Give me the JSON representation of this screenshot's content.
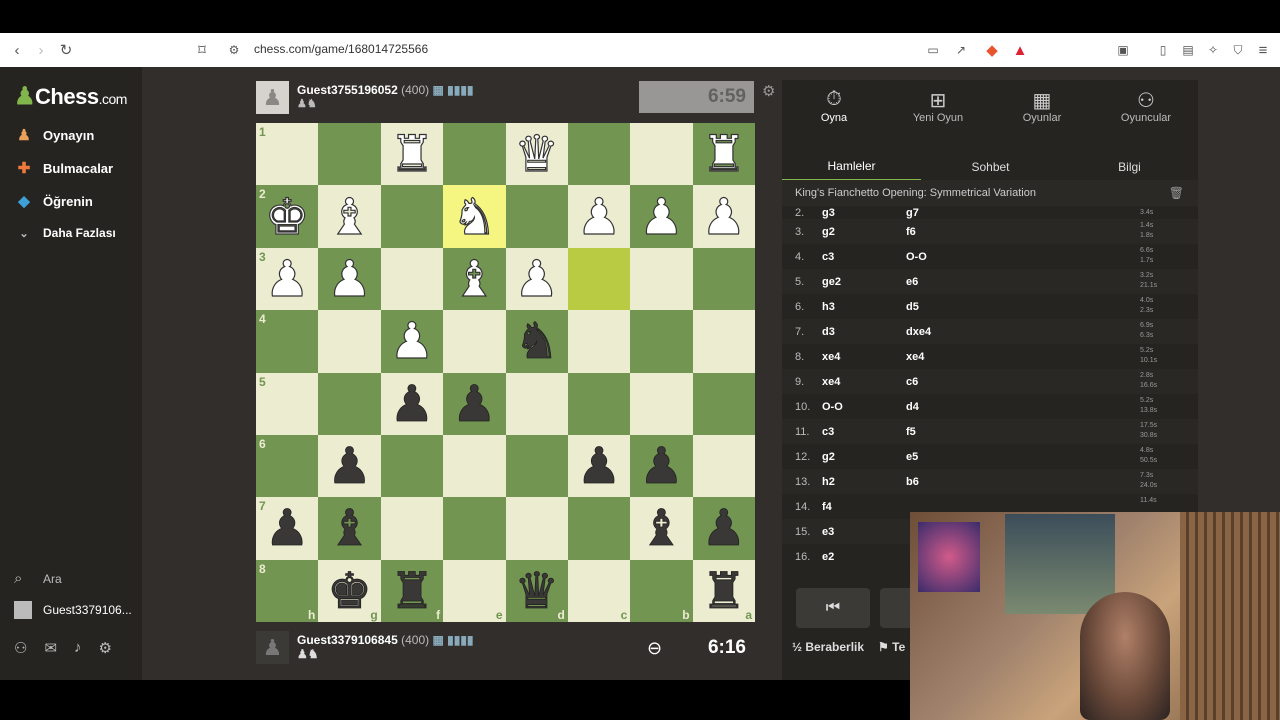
{
  "browser": {
    "url": "chess.com/game/168014725566"
  },
  "sidebar": {
    "logo_text": "Chess",
    "logo_suffix": ".com",
    "items": [
      {
        "label": "Oynayın",
        "icon": "play-icon"
      },
      {
        "label": "Bulmacalar",
        "icon": "puzzle-icon"
      },
      {
        "label": "Öğrenin",
        "icon": "learn-icon"
      },
      {
        "label": "Daha Fazlası",
        "icon": "chevron-down-icon"
      }
    ],
    "search_label": "Ara",
    "user_label": "Guest3379106..."
  },
  "top_player": {
    "name": "Guest3755196052",
    "rating": "(400)",
    "clock": "6:59"
  },
  "bottom_player": {
    "name": "Guest3379106845",
    "rating": "(400)",
    "clock": "6:16"
  },
  "board": {
    "ranks": [
      "1",
      "2",
      "3",
      "4",
      "5",
      "6",
      "7",
      "8"
    ],
    "files": [
      "h",
      "g",
      "f",
      "e",
      "d",
      "c",
      "b",
      "a"
    ],
    "rows": [
      [
        "",
        "",
        "wR",
        "",
        "wQ",
        "",
        "",
        "wR"
      ],
      [
        "wK",
        "wB",
        "",
        "wN",
        "",
        "wP",
        "wP",
        "wP"
      ],
      [
        "wP",
        "wP",
        "",
        "wB",
        "wP",
        "",
        "",
        ""
      ],
      [
        "",
        "",
        "wP",
        "",
        "bN",
        "",
        "",
        ""
      ],
      [
        "",
        "",
        "bP",
        "bP",
        "",
        "",
        "",
        ""
      ],
      [
        "",
        "bP",
        "",
        "",
        "",
        "bP",
        "bP",
        ""
      ],
      [
        "bP",
        "bB",
        "",
        "",
        "",
        "",
        "bB",
        "bP"
      ],
      [
        "",
        "bK",
        "bR",
        "",
        "bQ",
        "",
        "",
        "bR"
      ]
    ],
    "highlights": {
      "from": "f3",
      "to": "e2"
    }
  },
  "panel": {
    "top_tabs": [
      {
        "label": "Oyna",
        "icon": "stopwatch-icon"
      },
      {
        "label": "Yeni Oyun",
        "icon": "plus-icon"
      },
      {
        "label": "Oyunlar",
        "icon": "board-icon"
      },
      {
        "label": "Oyuncular",
        "icon": "players-icon"
      }
    ],
    "sub_tabs": [
      "Hamleler",
      "Sohbet",
      "Bilgi"
    ],
    "opening": "King's Fianchetto Opening: Symmetrical Variation",
    "moves": [
      {
        "n": "2.",
        "w": "g3",
        "b": "g7",
        "wt": "",
        "bt": "3.4s"
      },
      {
        "n": "3.",
        "w": "g2",
        "b": "f6",
        "wt": "1.4s",
        "bt": "1.8s"
      },
      {
        "n": "4.",
        "w": "c3",
        "b": "O-O",
        "wt": "6.6s",
        "bt": "1.7s"
      },
      {
        "n": "5.",
        "w": "ge2",
        "b": "e6",
        "wt": "3.2s",
        "bt": "21.1s"
      },
      {
        "n": "6.",
        "w": "h3",
        "b": "d5",
        "wt": "4.0s",
        "bt": "2.3s"
      },
      {
        "n": "7.",
        "w": "d3",
        "b": "dxe4",
        "wt": "6.9s",
        "bt": "6.3s"
      },
      {
        "n": "8.",
        "w": "xe4",
        "b": "xe4",
        "wt": "5.2s",
        "bt": "10.1s"
      },
      {
        "n": "9.",
        "w": "xe4",
        "b": "c6",
        "wt": "2.8s",
        "bt": "16.6s"
      },
      {
        "n": "10.",
        "w": "O-O",
        "b": "d4",
        "wt": "5.2s",
        "bt": "13.8s"
      },
      {
        "n": "11.",
        "w": "c3",
        "b": "f5",
        "wt": "17.5s",
        "bt": "30.8s"
      },
      {
        "n": "12.",
        "w": "g2",
        "b": "e5",
        "wt": "4.8s",
        "bt": "50.5s"
      },
      {
        "n": "13.",
        "w": "h2",
        "b": "b6",
        "wt": "7.3s",
        "bt": "24.0s"
      },
      {
        "n": "14.",
        "w": "f4",
        "b": "",
        "wt": "11.4s",
        "bt": ""
      },
      {
        "n": "15.",
        "w": "e3",
        "b": "",
        "wt": "",
        "bt": ""
      },
      {
        "n": "16.",
        "w": "e2",
        "b": "",
        "wt": "",
        "bt": ""
      }
    ],
    "draw_label": "Beraberlik",
    "resign_label": "Te"
  }
}
